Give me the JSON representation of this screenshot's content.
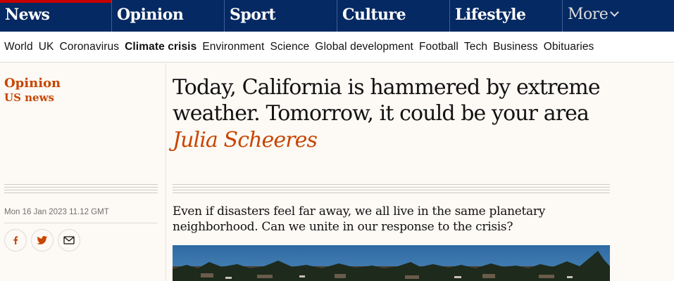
{
  "pillars": [
    {
      "label": "News",
      "color": "#c70000"
    },
    {
      "label": "Opinion",
      "color": "#e05e00"
    },
    {
      "label": "Sport",
      "color": "#0077b6"
    },
    {
      "label": "Culture",
      "color": "#a1845c"
    },
    {
      "label": "Lifestyle",
      "color": "#bb3b80"
    },
    {
      "label": "More"
    }
  ],
  "subnav": {
    "items": [
      "World",
      "UK",
      "Coronavirus",
      "Climate crisis",
      "Environment",
      "Science",
      "Global development",
      "Football",
      "Tech",
      "Business",
      "Obituaries"
    ],
    "active": "Climate crisis"
  },
  "article": {
    "section": "Opinion",
    "series": "US news",
    "headline": "Today, California is hammered by extreme weather. Tomorrow, it could be your area",
    "byline": "Julia Scheeres",
    "standfirst": "Even if disasters feel far away, we all live in the same planetary neighborhood. Can we unite in our response to the crisis?",
    "dateline": "Mon 16 Jan 2023 11.12 GMT"
  },
  "share": {
    "icons": [
      "facebook-icon",
      "twitter-icon",
      "email-icon"
    ]
  },
  "colors": {
    "brand": "#052962",
    "accent": "#c74600",
    "background": "#fdf9f5"
  }
}
